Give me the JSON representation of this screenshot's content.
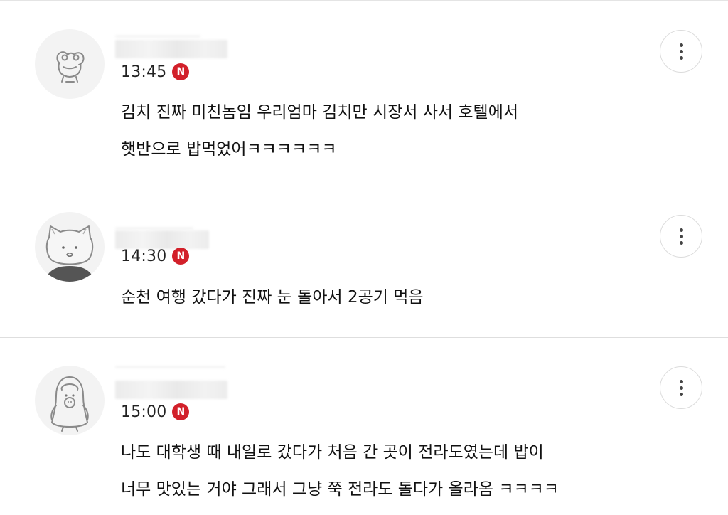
{
  "comments": [
    {
      "time": "13:45",
      "badge": "N",
      "avatar_icon": "frog-face-icon",
      "lines": [
        "김치 진짜 미친놈임 우리엄마 김치만 시장서 사서 호텔에서",
        "햇반으로 밥먹었어ㅋㅋㅋㅋㅋㅋ"
      ]
    },
    {
      "time": "14:30",
      "badge": "N",
      "avatar_icon": "cat-face-icon",
      "lines": [
        "순천 여행 갔다가 진짜 눈 돌아서 2공기 먹음"
      ]
    },
    {
      "time": "15:00",
      "badge": "N",
      "avatar_icon": "penguin-icon",
      "lines": [
        "나도 대학생 때 내일로 갔다가 처음 간 곳이 전라도였는데 밥이",
        "너무 맛있는 거야 그래서 그냥 쭉 전라도 돌다가 올라옴 ㅋㅋㅋㅋ"
      ]
    }
  ],
  "colors": {
    "badge": "#d2202a",
    "divider": "#dedede",
    "avatar_bg": "#f3f3f3",
    "text": "#111111"
  }
}
